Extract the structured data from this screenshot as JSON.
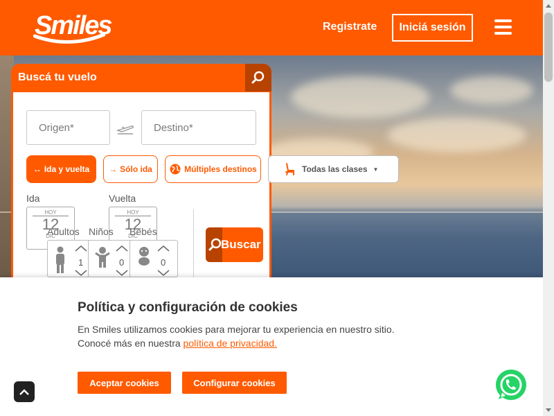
{
  "header": {
    "logo": "Smiles",
    "register_label": "Registrate",
    "login_label": "Iniciá sesión",
    "bg_color": "#ff5a00"
  },
  "search": {
    "title": "Buscá tu vuelo",
    "origin_placeholder": "Origen*",
    "destination_placeholder": "Destino*",
    "trip_types": [
      {
        "label": "Ida y vuelta",
        "active": true
      },
      {
        "label": "Sólo ida",
        "active": false
      },
      {
        "label": "Múltiples destinos",
        "active": false
      }
    ],
    "cabin_class": "Todas las clases",
    "outbound": {
      "label": "Ida",
      "today": "HOY",
      "day": "12",
      "month": "DIC"
    },
    "return": {
      "label": "Vuelta",
      "today": "HOY",
      "day": "12",
      "month": "DIC"
    },
    "passengers": [
      {
        "label": "Adultos",
        "count": "1"
      },
      {
        "label": "Niños",
        "count": "0"
      },
      {
        "label": "Bebés",
        "count": "0"
      }
    ],
    "search_button": "Buscar"
  },
  "cookies": {
    "title": "Política y configuración de cookies",
    "text_line1": "En Smiles utilizamos cookies para mejorar tu experiencia en nuestro sitio.",
    "text_line2": "Conocé más en nuestra",
    "link": "política de privacidad.",
    "accept_label": "Aceptar cookies",
    "configure_label": "Configurar cookies"
  },
  "icons": {
    "menu": "hamburger-icon",
    "search": "search-icon",
    "plane": "plane-icon",
    "globe": "globe-icon",
    "seat": "seat-icon",
    "whatsapp": "whatsapp-icon",
    "back_to_top": "chevron-up-icon"
  },
  "colors": {
    "accent": "#ff5a00",
    "accent_dark": "#b84200",
    "whatsapp": "#25d366"
  }
}
